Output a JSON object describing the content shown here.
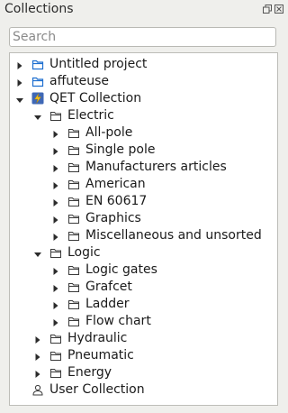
{
  "panel": {
    "title": "Collections"
  },
  "search": {
    "placeholder": "Search",
    "value": ""
  },
  "tree": [
    {
      "label": "Untitled project",
      "depth": 0,
      "state": "collapsed",
      "icon": "project-icon"
    },
    {
      "label": "affuteuse",
      "depth": 0,
      "state": "collapsed",
      "icon": "project-icon"
    },
    {
      "label": "QET Collection",
      "depth": 0,
      "state": "expanded",
      "icon": "qet-icon"
    },
    {
      "label": "Electric",
      "depth": 1,
      "state": "expanded",
      "icon": "folder-icon"
    },
    {
      "label": "All-pole",
      "depth": 2,
      "state": "collapsed",
      "icon": "folder-icon"
    },
    {
      "label": "Single pole",
      "depth": 2,
      "state": "collapsed",
      "icon": "folder-icon"
    },
    {
      "label": "Manufacturers articles",
      "depth": 2,
      "state": "collapsed",
      "icon": "folder-icon"
    },
    {
      "label": "American",
      "depth": 2,
      "state": "collapsed",
      "icon": "folder-icon"
    },
    {
      "label": "EN 60617",
      "depth": 2,
      "state": "collapsed",
      "icon": "folder-icon"
    },
    {
      "label": "Graphics",
      "depth": 2,
      "state": "collapsed",
      "icon": "folder-icon"
    },
    {
      "label": "Miscellaneous and unsorted",
      "depth": 2,
      "state": "collapsed",
      "icon": "folder-icon"
    },
    {
      "label": "Logic",
      "depth": 1,
      "state": "expanded",
      "icon": "folder-icon"
    },
    {
      "label": "Logic gates",
      "depth": 2,
      "state": "collapsed",
      "icon": "folder-icon"
    },
    {
      "label": "Grafcet",
      "depth": 2,
      "state": "collapsed",
      "icon": "folder-icon"
    },
    {
      "label": "Ladder",
      "depth": 2,
      "state": "collapsed",
      "icon": "folder-icon"
    },
    {
      "label": "Flow chart",
      "depth": 2,
      "state": "collapsed",
      "icon": "folder-icon"
    },
    {
      "label": "Hydraulic",
      "depth": 1,
      "state": "collapsed",
      "icon": "folder-icon"
    },
    {
      "label": "Pneumatic",
      "depth": 1,
      "state": "collapsed",
      "icon": "folder-icon"
    },
    {
      "label": "Energy",
      "depth": 1,
      "state": "collapsed",
      "icon": "folder-icon"
    },
    {
      "label": "User Collection",
      "depth": 0,
      "state": "leaf",
      "icon": "user-icon"
    }
  ],
  "colors": {
    "project_icon": "#1e6fd0",
    "qet_icon_bg": "#3f68b6",
    "qet_bolt": "#f3c21a",
    "arrow": "#2b2b2b"
  }
}
